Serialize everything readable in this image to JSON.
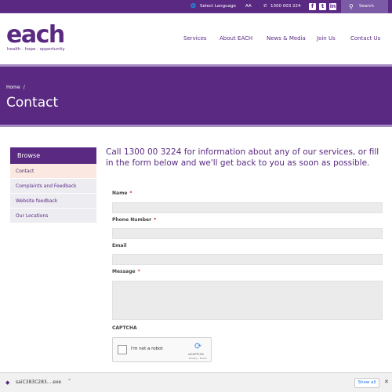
{
  "topbar": {
    "language_label": "Select Language",
    "text_size_label": "AA",
    "phone": "1300 003 224",
    "social": [
      "f",
      "t",
      "in"
    ],
    "search_label": "Search"
  },
  "header": {
    "logo_text": "each",
    "tagline": "health . hope . opportunity",
    "nav": [
      "Services",
      "About EACH",
      "News & Media",
      "Join Us",
      "Contact Us"
    ]
  },
  "banner": {
    "breadcrumb_home": "Home",
    "breadcrumb_sep": "/",
    "title": "Contact"
  },
  "sidebar": {
    "heading": "Browse",
    "items": [
      "Contact",
      "Complaints and Feedback",
      "Website feedback",
      "Our Locations"
    ]
  },
  "main": {
    "intro": "Call 1300 00 3224 for information about any of our services, or fill in the form below and we'll get back to you as soon as possible.",
    "fields": {
      "name_label": "Name",
      "phone_label": "Phone Number",
      "email_label": "Email",
      "message_label": "Message",
      "required_marker": "*"
    },
    "captcha_label": "CAPTCHA",
    "recaptcha": {
      "text": "I'm not a robot",
      "brand": "reCAPTCHA",
      "links": "Privacy - Terms"
    }
  },
  "downloads": {
    "file_name": "saiC383C283....exe",
    "show_all": "Show all"
  },
  "colors": {
    "brand_purple": "#5a2a82",
    "banner_border": "#a58cc2",
    "input_bg": "#ebebeb",
    "required": "#c0392b"
  },
  "icons": [
    "globe-icon",
    "phone-icon",
    "facebook-icon",
    "twitter-icon",
    "linkedin-icon",
    "search-icon",
    "recaptcha-logo-icon",
    "download-file-icon",
    "chevron-up-icon",
    "close-icon"
  ]
}
